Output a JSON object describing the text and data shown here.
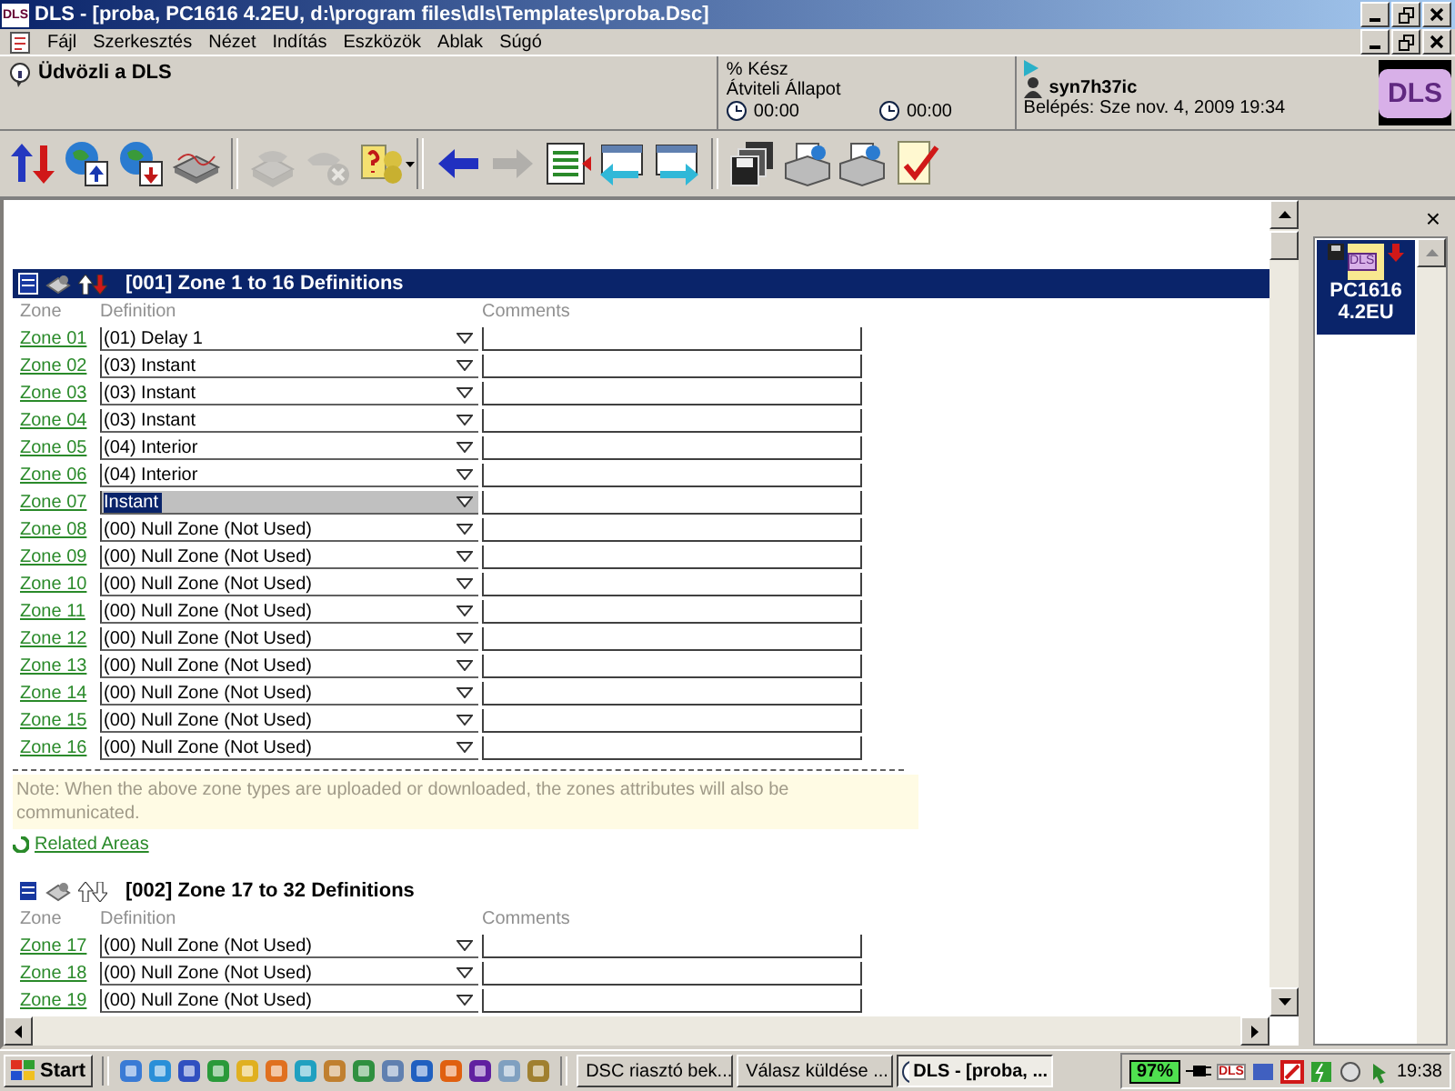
{
  "window": {
    "title": "DLS - [proba, PC1616 4.2EU, d:\\program files\\dls\\Templates\\proba.Dsc]",
    "logo": "DLS"
  },
  "menu": [
    "Fájl",
    "Szerkesztés",
    "Nézet",
    "Indítás",
    "Eszközök",
    "Ablak",
    "Súgó"
  ],
  "info": {
    "welcome": "Üdvözli a DLS",
    "progress_label": "% Kész",
    "transfer_label": "Átviteli Állapot",
    "timer_1": "00:00",
    "timer_2": "00:00",
    "user": "syn7h37ic",
    "login": "Belépés: Sze nov. 4, 2009 19:34",
    "logo": "DLS"
  },
  "toolbar": [
    {
      "kind": "updown",
      "disabled": false
    },
    {
      "kind": "upload",
      "disabled": false
    },
    {
      "kind": "download",
      "disabled": false
    },
    {
      "kind": "modem",
      "disabled": false
    },
    {
      "kind": "phone",
      "disabled": true
    },
    {
      "kind": "hangup",
      "disabled": true
    },
    {
      "kind": "help",
      "disabled": false
    },
    {
      "kind": "back",
      "disabled": false
    },
    {
      "kind": "forward",
      "disabled": true
    },
    {
      "kind": "list",
      "disabled": false
    },
    {
      "kind": "left",
      "disabled": false
    },
    {
      "kind": "right",
      "disabled": false
    },
    {
      "kind": "save",
      "disabled": false
    },
    {
      "kind": "print",
      "disabled": false
    },
    {
      "kind": "print",
      "disabled": false
    },
    {
      "kind": "check",
      "disabled": false
    }
  ],
  "sections": [
    {
      "title": "[001] Zone 1 to 16 Definitions",
      "highlighted": true,
      "columns": [
        "Zone",
        "Definition",
        "Comments"
      ],
      "rows": [
        {
          "zone": "Zone 01",
          "definition": "(01) Delay 1",
          "selected": false
        },
        {
          "zone": "Zone 02",
          "definition": "(03) Instant",
          "selected": false
        },
        {
          "zone": "Zone 03",
          "definition": "(03) Instant",
          "selected": false
        },
        {
          "zone": "Zone 04",
          "definition": "(03) Instant",
          "selected": false
        },
        {
          "zone": "Zone 05",
          "definition": "(04) Interior",
          "selected": false
        },
        {
          "zone": "Zone 06",
          "definition": "(04) Interior",
          "selected": false
        },
        {
          "zone": "Zone 07",
          "definition": "Instant",
          "selected": true
        },
        {
          "zone": "Zone 08",
          "definition": "(00) Null Zone (Not Used)",
          "selected": false
        },
        {
          "zone": "Zone 09",
          "definition": "(00) Null Zone (Not Used)",
          "selected": false
        },
        {
          "zone": "Zone 10",
          "definition": "(00) Null Zone (Not Used)",
          "selected": false
        },
        {
          "zone": "Zone 11",
          "definition": "(00) Null Zone (Not Used)",
          "selected": false
        },
        {
          "zone": "Zone 12",
          "definition": "(00) Null Zone (Not Used)",
          "selected": false
        },
        {
          "zone": "Zone 13",
          "definition": "(00) Null Zone (Not Used)",
          "selected": false
        },
        {
          "zone": "Zone 14",
          "definition": "(00) Null Zone (Not Used)",
          "selected": false
        },
        {
          "zone": "Zone 15",
          "definition": "(00) Null Zone (Not Used)",
          "selected": false
        },
        {
          "zone": "Zone 16",
          "definition": "(00) Null Zone (Not Used)",
          "selected": false
        }
      ],
      "note": "Note: When the above zone types are uploaded or downloaded, the zones attributes will also be communicated.",
      "link": "Related Areas"
    },
    {
      "title": "[002] Zone 17 to 32 Definitions",
      "highlighted": false,
      "columns": [
        "Zone",
        "Definition",
        "Comments"
      ],
      "rows": [
        {
          "zone": "Zone 17",
          "definition": "(00) Null Zone (Not Used)",
          "selected": false
        },
        {
          "zone": "Zone 18",
          "definition": "(00) Null Zone (Not Used)",
          "selected": false
        },
        {
          "zone": "Zone 19",
          "definition": "(00) Null Zone (Not Used)",
          "selected": false
        }
      ]
    }
  ],
  "side_panel": {
    "icon_label": "DLS",
    "label_1": "PC1616",
    "label_2": "4.2EU",
    "close": "×"
  },
  "taskbar": {
    "start": "Start",
    "tasks": [
      {
        "label": "DSC riasztó bek...",
        "selected": false
      },
      {
        "label": "Válasz küldése ...",
        "selected": false
      },
      {
        "label": "DLS - [proba, ...",
        "selected": true
      }
    ],
    "battery": "97%",
    "tray_label": "DLS",
    "clock": "19:38"
  }
}
